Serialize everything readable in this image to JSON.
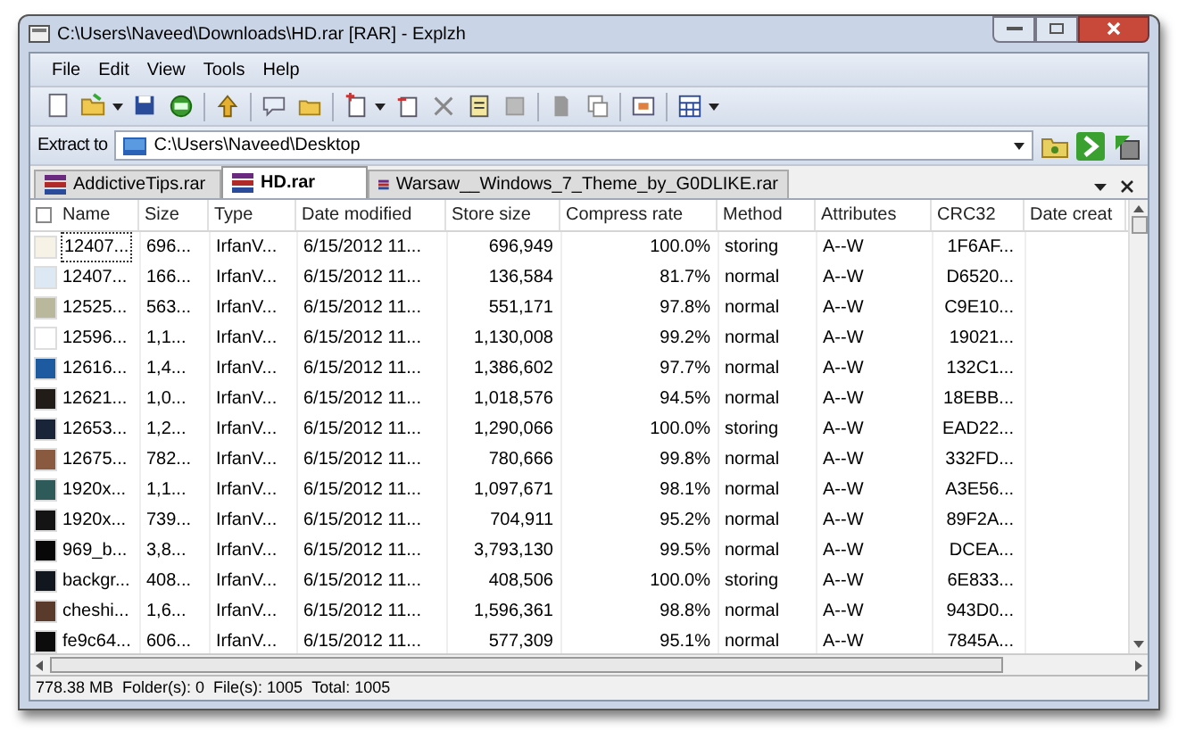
{
  "window": {
    "title": "C:\\Users\\Naveed\\Downloads\\HD.rar [RAR] - Explzh"
  },
  "menu": [
    "File",
    "Edit",
    "View",
    "Tools",
    "Help"
  ],
  "extract": {
    "label": "Extract to",
    "path": "C:\\Users\\Naveed\\Desktop"
  },
  "tabs": [
    {
      "label": "AddictiveTips.rar",
      "selected": false
    },
    {
      "label": "HD.rar",
      "selected": true
    },
    {
      "label": "Warsaw__Windows_7_Theme_by_G0DLIKE.rar",
      "selected": false
    }
  ],
  "table": {
    "select_all_checked": false,
    "columns": [
      "Name",
      "Size",
      "Type",
      "Date modified",
      "Store size",
      "Compress rate",
      "Method",
      "Attributes",
      "CRC32",
      "Date creat"
    ],
    "rows": [
      {
        "color": "#f6f3e6",
        "focused": true,
        "cells": [
          "12407...",
          "696...",
          "IrfanV...",
          "6/15/2012 11...",
          "696,949",
          "100.0%",
          "storing",
          "A--W",
          "1F6AF..."
        ]
      },
      {
        "color": "#dce8f4",
        "focused": false,
        "cells": [
          "12407...",
          "166...",
          "IrfanV...",
          "6/15/2012 11...",
          "136,584",
          "81.7%",
          "normal",
          "A--W",
          "D6520..."
        ]
      },
      {
        "color": "#b9b79c",
        "focused": false,
        "cells": [
          "12525...",
          "563...",
          "IrfanV...",
          "6/15/2012 11...",
          "551,171",
          "97.8%",
          "normal",
          "A--W",
          "C9E10..."
        ]
      },
      {
        "color": "#ffffff",
        "focused": false,
        "cells": [
          "12596...",
          "1,1...",
          "IrfanV...",
          "6/15/2012 11...",
          "1,130,008",
          "99.2%",
          "normal",
          "A--W",
          "19021..."
        ]
      },
      {
        "color": "#1d5aa0",
        "focused": false,
        "cells": [
          "12616...",
          "1,4...",
          "IrfanV...",
          "6/15/2012 11...",
          "1,386,602",
          "97.7%",
          "normal",
          "A--W",
          "132C1..."
        ]
      },
      {
        "color": "#221c18",
        "focused": false,
        "cells": [
          "12621...",
          "1,0...",
          "IrfanV...",
          "6/15/2012 11...",
          "1,018,576",
          "94.5%",
          "normal",
          "A--W",
          "18EBB..."
        ]
      },
      {
        "color": "#1a2438",
        "focused": false,
        "cells": [
          "12653...",
          "1,2...",
          "IrfanV...",
          "6/15/2012 11...",
          "1,290,066",
          "100.0%",
          "storing",
          "A--W",
          "EAD22..."
        ]
      },
      {
        "color": "#8a5a40",
        "focused": false,
        "cells": [
          "12675...",
          "782...",
          "IrfanV...",
          "6/15/2012 11...",
          "780,666",
          "99.8%",
          "normal",
          "A--W",
          "332FD..."
        ]
      },
      {
        "color": "#2e5a5a",
        "focused": false,
        "cells": [
          "1920x...",
          "1,1...",
          "IrfanV...",
          "6/15/2012 11...",
          "1,097,671",
          "98.1%",
          "normal",
          "A--W",
          "A3E56..."
        ]
      },
      {
        "color": "#141414",
        "focused": false,
        "cells": [
          "1920x...",
          "739...",
          "IrfanV...",
          "6/15/2012 11...",
          "704,911",
          "95.2%",
          "normal",
          "A--W",
          "89F2A..."
        ]
      },
      {
        "color": "#080808",
        "focused": false,
        "cells": [
          "969_b...",
          "3,8...",
          "IrfanV...",
          "6/15/2012 11...",
          "3,793,130",
          "99.5%",
          "normal",
          "A--W",
          "DCEA..."
        ]
      },
      {
        "color": "#12161e",
        "focused": false,
        "cells": [
          "backgr...",
          "408...",
          "IrfanV...",
          "6/15/2012 11...",
          "408,506",
          "100.0%",
          "storing",
          "A--W",
          "6E833..."
        ]
      },
      {
        "color": "#5a3a2a",
        "focused": false,
        "cells": [
          "cheshi...",
          "1,6...",
          "IrfanV...",
          "6/15/2012 11...",
          "1,596,361",
          "98.8%",
          "normal",
          "A--W",
          "943D0..."
        ]
      },
      {
        "color": "#0c0c0c",
        "focused": false,
        "cells": [
          "fe9c64...",
          "606...",
          "IrfanV...",
          "6/15/2012 11...",
          "577,309",
          "95.1%",
          "normal",
          "A--W",
          "7845A..."
        ]
      }
    ]
  },
  "status_bar": [
    "778.38 MB",
    "Folder(s): 0",
    "File(s): 1005",
    "Total: 1005"
  ]
}
